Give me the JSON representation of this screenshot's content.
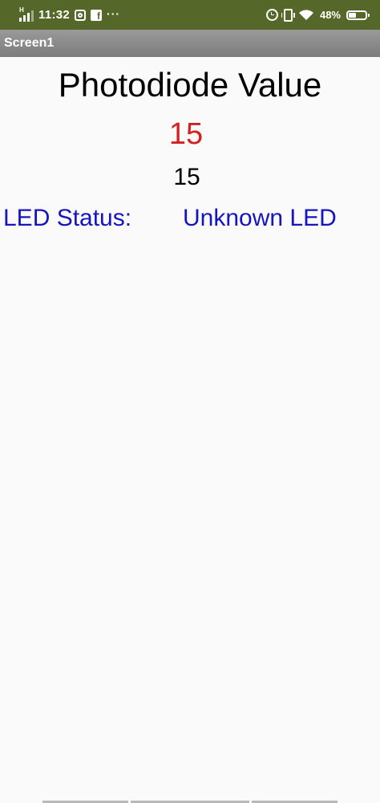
{
  "status_bar": {
    "network_type": "H",
    "time": "11:32",
    "overflow": "···",
    "battery_percent": "48%",
    "battery_level": 0.48,
    "icons": [
      "signal-icon",
      "instagram-icon",
      "facebook-icon",
      "alarm-icon",
      "vibrate-icon",
      "wifi-icon",
      "battery-icon"
    ]
  },
  "app": {
    "screen_title": "Screen1"
  },
  "main": {
    "heading": "Photodiode Value",
    "value_primary": "15",
    "value_secondary": "15",
    "led_label": "LED Status:",
    "led_value": "Unknown LED"
  },
  "colors": {
    "status_bar": "#55682a",
    "title_bar": "#8a8a8a",
    "background": "#fafafa",
    "value_primary": "#d32121",
    "led_text": "#1515c0"
  }
}
